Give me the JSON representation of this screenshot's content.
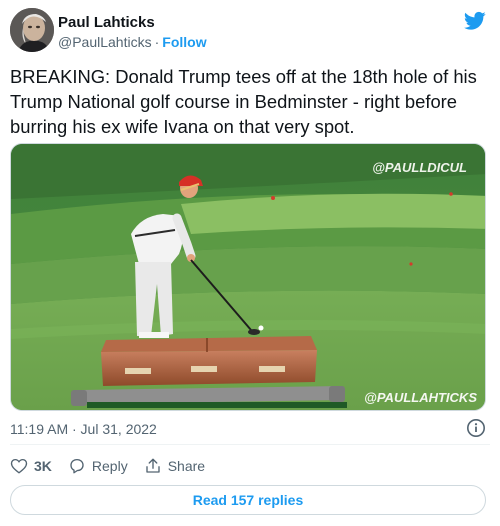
{
  "author": {
    "display_name": "Paul Lahticks",
    "handle": "@PaulLahticks",
    "separator": "·",
    "follow_label": "Follow"
  },
  "tweet": {
    "text": "BREAKING: Donald Trump tees off at the 18th hole of his Trump National golf course in Bedminster - right before burring his ex wife Ivana on that very spot."
  },
  "media": {
    "watermark_top": "@PAULLDICUL",
    "watermark_bottom": "@PAULLAHTICKS"
  },
  "meta": {
    "timestamp": "11:19 AM · Jul 31, 2022"
  },
  "actions": {
    "like_count": "3K",
    "reply_label": "Reply",
    "share_label": "Share"
  },
  "replies": {
    "label": "Read 157 replies"
  },
  "colors": {
    "accent": "#1d9bf0",
    "secondary_text": "#536471"
  },
  "icons": [
    "twitter-bird-icon",
    "info-icon",
    "heart-icon",
    "reply-icon",
    "share-icon"
  ]
}
